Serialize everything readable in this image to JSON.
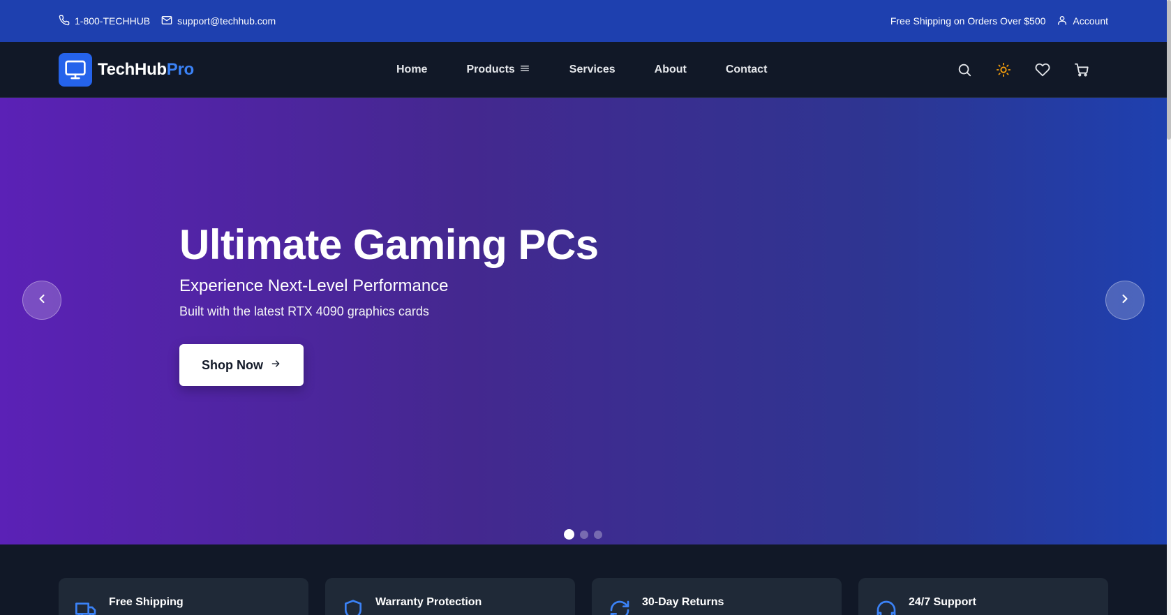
{
  "topbar": {
    "phone": "1-800-TECHHUB",
    "email": "support@techhub.com",
    "shipping": "Free Shipping on Orders Over $500",
    "account": "Account"
  },
  "brand": {
    "name": "TechHub",
    "suffix": "Pro"
  },
  "nav": {
    "items": [
      {
        "label": "Home"
      },
      {
        "label": "Products"
      },
      {
        "label": "Services"
      },
      {
        "label": "About"
      },
      {
        "label": "Contact"
      }
    ]
  },
  "icons": {
    "header": [
      "search-icon",
      "sun-icon",
      "heart-icon",
      "cart-icon"
    ],
    "hero": [
      "chevron-left-icon",
      "chevron-right-icon",
      "arrow-right-icon"
    ]
  },
  "hero": {
    "title": "Ultimate Gaming PCs",
    "subtitle": "Experience Next-Level Performance",
    "description": "Built with the latest RTX 4090 graphics cards",
    "cta": "Shop Now",
    "slide_count": 3,
    "active_slide": 1
  },
  "features": [
    {
      "title": "Free Shipping",
      "icon": "truck-icon"
    },
    {
      "title": "Warranty Protection",
      "icon": "shield-icon"
    },
    {
      "title": "30-Day Returns",
      "icon": "refresh-icon"
    },
    {
      "title": "24/7 Support",
      "icon": "headphones-icon"
    }
  ],
  "colors": {
    "topbar": "#1e40af",
    "nav": "#111827",
    "accent": "#2563eb",
    "brand_suffix": "#3b82f6",
    "hero_gradient_start": "#5b21b6",
    "hero_gradient_end": "#1e40af",
    "sun": "#f59e0b",
    "card": "#1f2937"
  }
}
